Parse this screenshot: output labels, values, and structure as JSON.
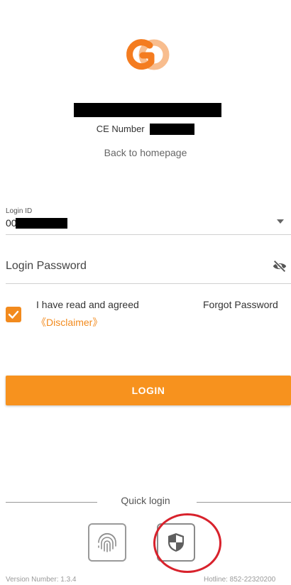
{
  "header": {
    "logo": "go-logo-icon",
    "ce_number_label": "CE Number",
    "back_link": "Back to homepage"
  },
  "form": {
    "login_id_label": "Login ID",
    "login_id_value": "00",
    "password_placeholder": "Login Password",
    "agree_text": "I have read and agreed",
    "agree_checked": true,
    "disclaimer_link": "《Disclaimer》",
    "forgot_password": "Forgot Password",
    "login_button": "LOGIN"
  },
  "quick_login": {
    "label": "Quick login",
    "options": [
      "fingerprint-icon",
      "shield-icon"
    ]
  },
  "footer": {
    "version": "Version Number:  1.3.4",
    "hotline": "Hotline:  852-22320200"
  },
  "colors": {
    "accent": "#f7921e",
    "annotation_circle": "#d8222c"
  }
}
